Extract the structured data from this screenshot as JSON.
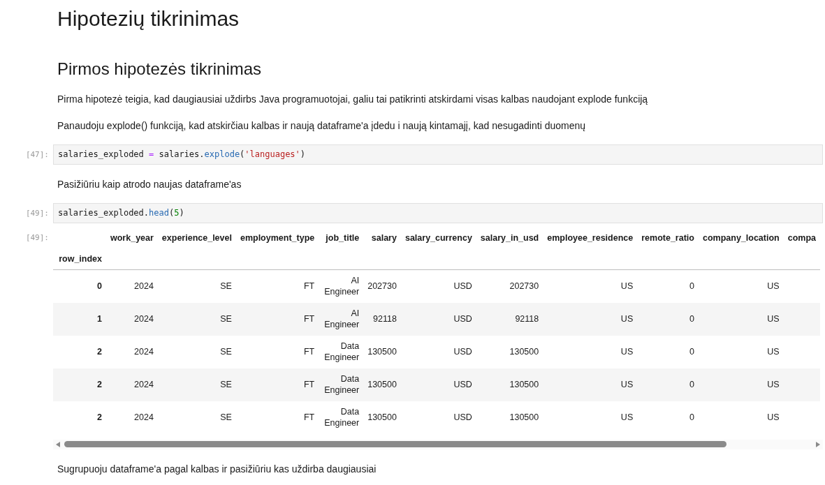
{
  "cells": [
    {
      "kind": "h1",
      "text": "Hipotezių tikrinimas"
    },
    {
      "kind": "h2",
      "text": "Pirmos hipotezės tikrinimas"
    },
    {
      "kind": "p",
      "text": "Pirma hipotezė teigia, kad daugiausiai uždirbs Java programuotojai, galiu tai patikrinti atskirdami visas kalbas naudojant explode funkciją"
    },
    {
      "kind": "p",
      "text": "Panaudoju explode() funkciją, kad atskirčiau kalbas ir naują dataframe'a įdedu i naują kintamajį, kad nesugadinti duomenų"
    },
    {
      "kind": "code",
      "prompt": "[47]:",
      "tokens": [
        {
          "kind": "name",
          "text": "salaries_exploded "
        },
        {
          "kind": "op",
          "text": "="
        },
        {
          "kind": "name",
          "text": " salaries."
        },
        {
          "kind": "func",
          "text": "explode"
        },
        {
          "kind": "name",
          "text": "("
        },
        {
          "kind": "string",
          "text": "'languages'"
        },
        {
          "kind": "name",
          "text": ")"
        }
      ]
    },
    {
      "kind": "p",
      "text": "Pasižiūriu kaip atrodo naujas dataframe'as"
    },
    {
      "kind": "code",
      "prompt": "[49]:",
      "tokens": [
        {
          "kind": "name",
          "text": "salaries_exploded."
        },
        {
          "kind": "func",
          "text": "head"
        },
        {
          "kind": "name",
          "text": "("
        },
        {
          "kind": "number",
          "text": "5"
        },
        {
          "kind": "name",
          "text": ")"
        }
      ]
    },
    {
      "kind": "table",
      "prompt": "[49]:",
      "index_name": "row_index",
      "columns": [
        "work_year",
        "experience_level",
        "employment_type",
        "job_title",
        "salary",
        "salary_currency",
        "salary_in_usd",
        "employee_residence",
        "remote_ratio",
        "company_location",
        "compa"
      ],
      "rows": [
        {
          "index": "0",
          "cells": [
            "2024",
            "SE",
            "FT",
            "AI Engineer",
            "202730",
            "USD",
            "202730",
            "US",
            "0",
            "US"
          ]
        },
        {
          "index": "1",
          "cells": [
            "2024",
            "SE",
            "FT",
            "AI Engineer",
            "92118",
            "USD",
            "92118",
            "US",
            "0",
            "US"
          ]
        },
        {
          "index": "2",
          "cells": [
            "2024",
            "SE",
            "FT",
            "Data Engineer",
            "130500",
            "USD",
            "130500",
            "US",
            "0",
            "US"
          ]
        },
        {
          "index": "2",
          "cells": [
            "2024",
            "SE",
            "FT",
            "Data Engineer",
            "130500",
            "USD",
            "130500",
            "US",
            "0",
            "US"
          ]
        },
        {
          "index": "2",
          "cells": [
            "2024",
            "SE",
            "FT",
            "Data Engineer",
            "130500",
            "USD",
            "130500",
            "US",
            "0",
            "US"
          ]
        }
      ]
    },
    {
      "kind": "p",
      "text": "Sugrupuoju dataframe'a pagal kalbas ir pasižiūriu kas uždirba daugiausiai"
    }
  ]
}
